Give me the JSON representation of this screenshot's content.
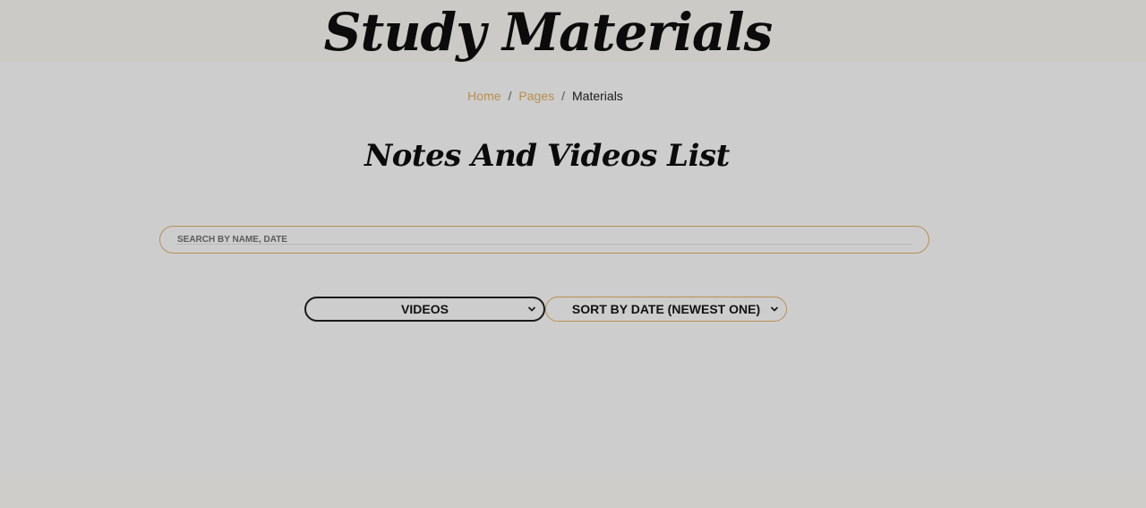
{
  "header": {
    "title": "Study Materials"
  },
  "breadcrumb": {
    "items": [
      "Home",
      "Pages"
    ],
    "separator": "/",
    "current": "Materials"
  },
  "section": {
    "title": "Notes And Videos List"
  },
  "search": {
    "placeholder": "SEARCH BY NAME, DATE",
    "value": ""
  },
  "filters": {
    "type_selected": "VIDEOS",
    "sort_selected": "SORT BY DATE (NEWEST ONE)"
  },
  "icons": {
    "dropdown": "chevron-down-icon"
  },
  "colors": {
    "accent": "#b98f53",
    "background": "#cdcdcd",
    "text": "#0b0b0b"
  }
}
